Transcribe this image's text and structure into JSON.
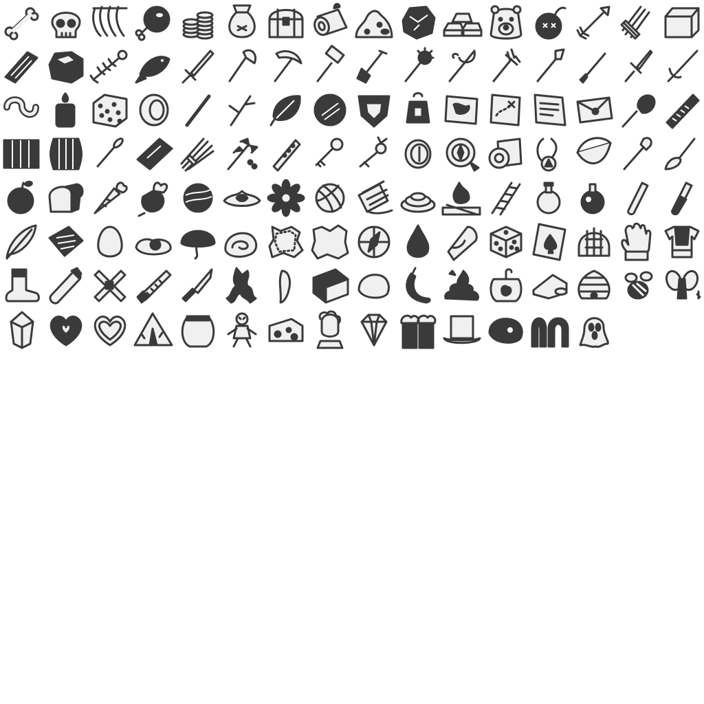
{
  "sheet": {
    "colors": {
      "ink": "#3a3a3a",
      "fill": "#f0f0f0",
      "background": "#ffffff"
    },
    "rows": [
      [
        "bone-icon",
        "skull-icon",
        "ribcage-icon",
        "meat-bone-icon",
        "coin-stacks-icon",
        "money-bag-icon",
        "treasure-chest-icon",
        "log-icon",
        "ore-pile-icon",
        "coal-ore-icon",
        "ingots-icon",
        "bear-icon",
        "bomb-icon",
        "arrow-icon",
        "arrow-bundle-icon",
        "stone-block-icon"
      ],
      [
        "scribble-icon",
        "rock-icon",
        "fish-skeleton-icon",
        "fish-icon",
        "sword-icon",
        "axe-icon",
        "pickaxe-icon",
        "hammer-icon",
        "shovel-icon",
        "mace-icon",
        "fishing-rod-icon",
        "pitchfork-icon",
        "spear-icon",
        "staff-icon",
        "dagger-icon",
        "rapier-icon"
      ],
      [
        "worm-icon",
        "candle-icon",
        "sponge-icon",
        "tape-roll-icon",
        "stick-icon",
        "branch-icon",
        "leaf-icon",
        "round-shield-icon",
        "crest-shield-icon",
        "lantern-icon",
        "map-icon",
        "treasure-map-icon",
        "letter-icon",
        "envelope-icon",
        "magnifier-icon",
        "comb-icon"
      ],
      [
        "crate-icon",
        "barrel-icon",
        "nail-icon",
        "plank-icon",
        "wheat-bundle-icon",
        "herb-bundle-icon",
        "flute-icon",
        "key-icon",
        "ornate-key-icon",
        "coin-icon",
        "compass-device-icon",
        "scroll-roll-icon",
        "amulet-icon",
        "bow-icon",
        "wand-icon",
        "brush-icon"
      ],
      [
        "apple-icon",
        "bread-icon",
        "carrot-icon",
        "beet-icon",
        "striped-ball-icon",
        "lettuce-icon",
        "flower-icon",
        "yarn-ball-icon",
        "thread-spool-icon",
        "rope-coil-icon",
        "campfire-icon",
        "ladder-icon",
        "round-flask-icon",
        "potion-flask-icon",
        "test-tube-icon",
        "red-vial-icon"
      ],
      [
        "feather-icon",
        "woven-basket-icon",
        "egg-icon",
        "fried-egg-icon",
        "mushroom-icon",
        "cinnamon-roll-icon",
        "leather-hide-icon",
        "fur-pelt-icon",
        "compass-icon",
        "drop-icon",
        "candy-corn-icon",
        "dice-icon",
        "playing-card-icon",
        "helmet-icon",
        "glove-icon",
        "chest-armor-icon"
      ],
      [
        "boot-icon",
        "scroll-tube-icon",
        "crossed-scrolls-icon",
        "saw-icon",
        "knife-icon",
        "root-icon",
        "tooth-icon",
        "book-icon",
        "blob-icon",
        "chili-icon",
        "poop-icon",
        "jar-icon",
        "cheese-wedge-icon",
        "beehive-icon",
        "bee-icon",
        "fairy-icon"
      ],
      [
        "gem-icon",
        "dark-heart-icon",
        "heart-icon",
        "tent-icon",
        "fishbowl-icon",
        "voodoo-doll-icon",
        "swiss-cheese-icon",
        "bust-icon",
        "diamond-icon",
        "beer-mugs-icon",
        "puddle-box-icon",
        "dark-rock-icon",
        "arch-icon",
        "ghost-icon"
      ]
    ]
  }
}
